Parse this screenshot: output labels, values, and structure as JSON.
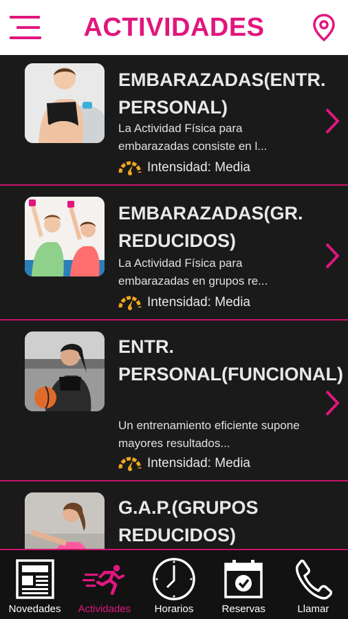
{
  "header": {
    "title": "ACTIVIDADES"
  },
  "activities": [
    {
      "title": "EMBARAZADAS(ENTR. PERSONAL)",
      "description": "La Actividad Física para embarazadas consiste en l...",
      "intensity": "Intensidad: Media"
    },
    {
      "title": "EMBARAZADAS(GR. REDUCIDOS)",
      "description": "La Actividad Física para embarazadas en grupos re...",
      "intensity": "Intensidad: Media"
    },
    {
      "title": "ENTR. PERSONAL(FUNCIONAL)",
      "description": "Un entrenamiento eficiente supone mayores resultados...",
      "intensity": "Intensidad: Media"
    },
    {
      "title": "G.A.P.(GRUPOS REDUCIDOS)",
      "description": "",
      "intensity": ""
    }
  ],
  "tabs": [
    {
      "label": "Novedades",
      "icon": "newspaper-icon"
    },
    {
      "label": "Actividades",
      "icon": "running-icon",
      "active": true
    },
    {
      "label": "Horarios",
      "icon": "clock-icon"
    },
    {
      "label": "Reservas",
      "icon": "calendar-check-icon"
    },
    {
      "label": "Llamar",
      "icon": "phone-icon"
    }
  ],
  "colors": {
    "accent": "#e0167e",
    "background": "#141414",
    "gauge": "#f2a81d"
  }
}
